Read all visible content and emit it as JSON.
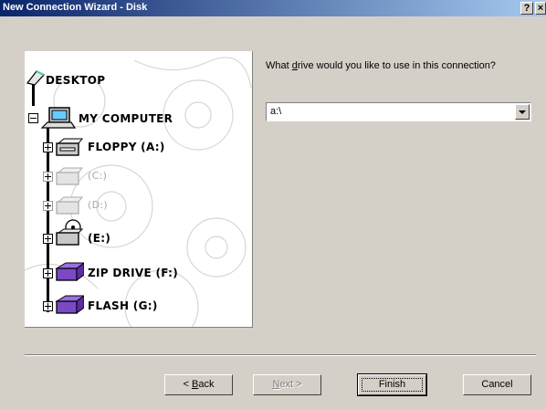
{
  "window": {
    "title": "New Connection Wizard - Disk",
    "help_label": "?",
    "close_label": "×"
  },
  "tree": {
    "root": "DESKTOP",
    "computer": "MY COMPUTER",
    "drives": [
      {
        "label": "FLOPPY (A:)",
        "icon": "floppy-drive-icon",
        "available": true
      },
      {
        "label": "(C:)",
        "icon": "hard-drive-icon",
        "available": false
      },
      {
        "label": "(D:)",
        "icon": "hard-drive-icon",
        "available": false
      },
      {
        "label": "(E:)",
        "icon": "cd-drive-icon",
        "available": true
      },
      {
        "label": "ZIP DRIVE (F:)",
        "icon": "zip-drive-icon",
        "available": true
      },
      {
        "label": "FLASH (G:)",
        "icon": "flash-drive-icon",
        "available": true
      }
    ]
  },
  "form": {
    "question": "What drive would you like to use in this connection?",
    "question_pre": "What ",
    "question_accel": "d",
    "question_post": "rive would you like to use in this connection?",
    "drive_value": "a:\\"
  },
  "buttons": {
    "back_pre": "< ",
    "back_accel": "B",
    "back_post": "ack",
    "next_accel": "N",
    "next_post": "ext >",
    "finish": "Finish",
    "cancel": "Cancel"
  },
  "colors": {
    "dialog_bg": "#d4d0c8",
    "title_start": "#0a246a",
    "title_end": "#a6caf0",
    "zip_purple": "#7b49c4"
  }
}
